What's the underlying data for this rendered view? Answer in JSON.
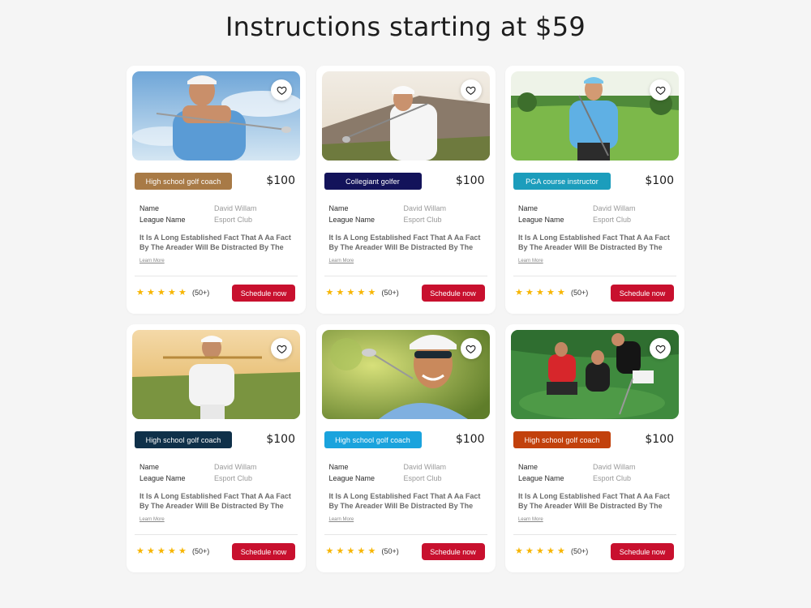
{
  "page": {
    "title": "Instructions starting at $59"
  },
  "cards": [
    {
      "tag": "High school golf coach",
      "tag_color": "#a87a46",
      "price": "$100",
      "name_label": "Name",
      "name_value": "David Willam",
      "league_label": "League Name",
      "league_value": "Esport Club",
      "description": "It Is A Long Established Fact That A Aa Fact By The  Areader Will Be Distracted By The",
      "learn_more": "Learn More",
      "stars": 5,
      "reviews": "(50+)",
      "button": "Schedule now",
      "photo": "golfer-swing-sky"
    },
    {
      "tag": "Collegiant golfer",
      "tag_color": "#13135a",
      "price": "$100",
      "name_label": "Name",
      "name_value": "David Willam",
      "league_label": "League Name",
      "league_value": "Esport Club",
      "description": "It Is A Long Established Fact That A Aa Fact By The  Areader Will Be Distracted By The",
      "learn_more": "Learn More",
      "stars": 5,
      "reviews": "(50+)",
      "button": "Schedule now",
      "photo": "golfer-swing-mountains"
    },
    {
      "tag": "PGA course instructor",
      "tag_color": "#1c9dbc",
      "price": "$100",
      "name_label": "Name",
      "name_value": "David Willam",
      "league_label": "League Name",
      "league_value": "Esport Club",
      "description": "It Is A Long Established Fact That A Aa Fact By The  Areader Will Be Distracted By The",
      "learn_more": "Learn More",
      "stars": 5,
      "reviews": "(50+)",
      "button": "Schedule now",
      "photo": "golfer-standing-course"
    },
    {
      "tag": "High school golf coach",
      "tag_color": "#0f3049",
      "price": "$100",
      "name_label": "Name",
      "name_value": "David Willam",
      "league_label": "League Name",
      "league_value": "Esport Club",
      "description": "It Is A Long Established Fact That A Aa Fact By The  Areader Will Be Distracted By The",
      "learn_more": "Learn More",
      "stars": 5,
      "reviews": "(50+)",
      "button": "Schedule now",
      "photo": "golfer-club-shoulders-sunset"
    },
    {
      "tag": "High school golf coach",
      "tag_color": "#1aa3dd",
      "price": "$100",
      "name_label": "Name",
      "name_value": "David Willam",
      "league_label": "League Name",
      "league_value": "Esport Club",
      "description": "It Is A Long Established Fact That A Aa Fact By The  Areader Will Be Distracted By The",
      "learn_more": "Learn More",
      "stars": 5,
      "reviews": "(50+)",
      "button": "Schedule now",
      "photo": "golfer-smiling-sunglasses"
    },
    {
      "tag": "High school golf coach",
      "tag_color": "#c2410c",
      "price": "$100",
      "name_label": "Name",
      "name_value": "David Willam",
      "league_label": "League Name",
      "league_value": "Esport Club",
      "description": "It Is A Long Established Fact That A Aa Fact By The  Areader Will Be Distracted By The",
      "learn_more": "Learn More",
      "stars": 5,
      "reviews": "(50+)",
      "button": "Schedule now",
      "photo": "golfers-putting-green"
    }
  ],
  "colors": {
    "background": "#f5f5f5",
    "star": "#f7b500",
    "button": "#c8102e"
  }
}
